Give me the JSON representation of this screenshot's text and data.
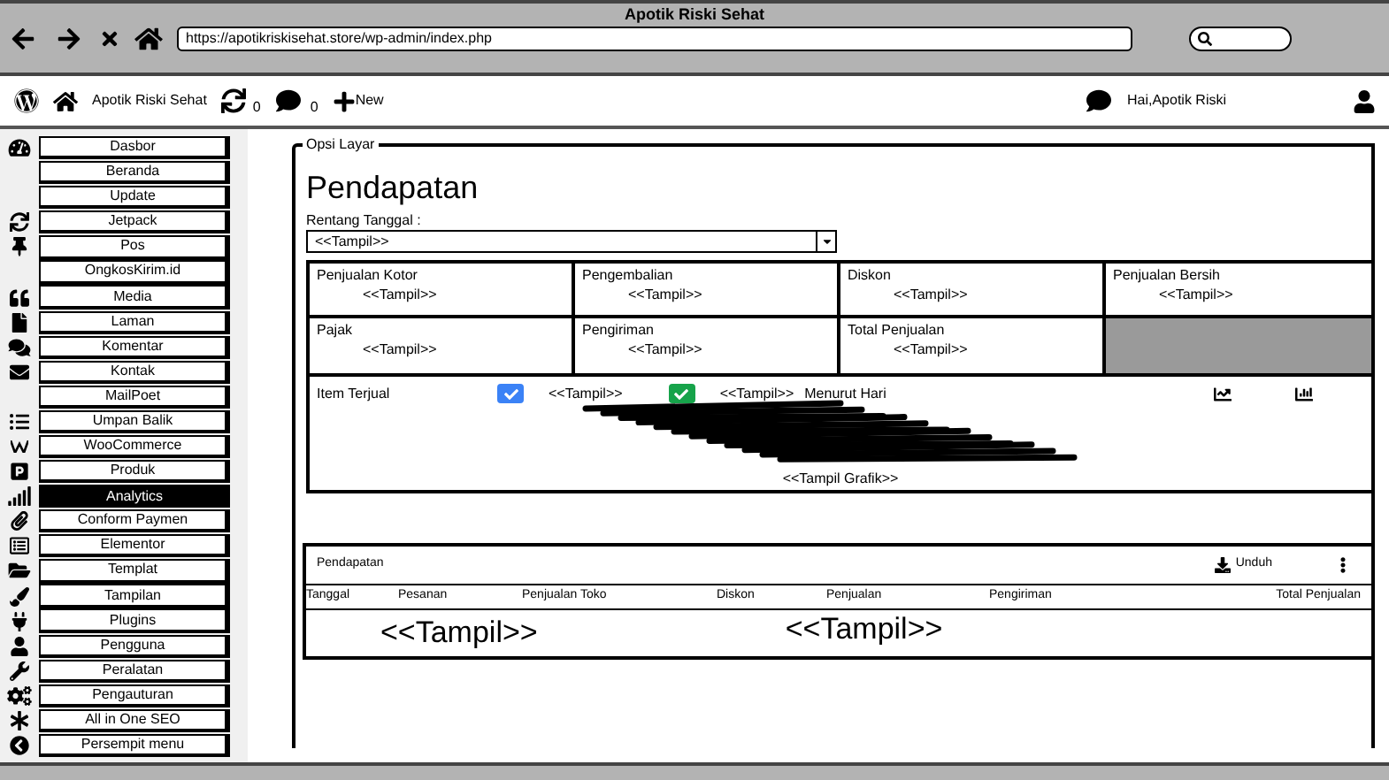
{
  "browser": {
    "title": "Apotik Riski Sehat",
    "url": "https://apotikriskisehat.store/wp-admin/index.php"
  },
  "admin_bar": {
    "site": "Apotik Riski Sehat",
    "updates": "0",
    "comments": "0",
    "new": "New",
    "greeting": "Hai,Apotik Riski"
  },
  "sidebar": {
    "items": [
      {
        "label": "Dasbor",
        "selected": false
      },
      {
        "label": "Beranda",
        "selected": false
      },
      {
        "label": "Update",
        "selected": false
      },
      {
        "label": "Jetpack",
        "selected": false
      },
      {
        "label": "Pos",
        "selected": false
      },
      {
        "label": "OngkosKirim.id",
        "selected": false
      },
      {
        "label": "Media",
        "selected": false
      },
      {
        "label": "Laman",
        "selected": false
      },
      {
        "label": "Komentar",
        "selected": false
      },
      {
        "label": "Kontak",
        "selected": false
      },
      {
        "label": "MailPoet",
        "selected": false
      },
      {
        "label": "Umpan Balik",
        "selected": false
      },
      {
        "label": "WooCommerce",
        "selected": false
      },
      {
        "label": "Produk",
        "selected": false
      },
      {
        "label": "Analytics",
        "selected": true
      },
      {
        "label": "Conform Paymen",
        "selected": false
      },
      {
        "label": "Elementor",
        "selected": false
      },
      {
        "label": "Templat",
        "selected": false
      },
      {
        "label": "Tampilan",
        "selected": false
      },
      {
        "label": "Plugins",
        "selected": false
      },
      {
        "label": "Pengguna",
        "selected": false
      },
      {
        "label": "Peralatan",
        "selected": false
      },
      {
        "label": "Pengauturan",
        "selected": false
      },
      {
        "label": "All in One SEO",
        "selected": false
      },
      {
        "label": "Persempit menu",
        "selected": false
      }
    ]
  },
  "screen_options": "Opsi Layar",
  "page_title": "Pendapatan",
  "date_range": {
    "label": "Rentang Tanggal :",
    "value": "<<Tampil>>"
  },
  "stats": [
    {
      "label": "Penjualan Kotor",
      "value": "<<Tampil>>"
    },
    {
      "label": "Pengembalian",
      "value": "<<Tampil>>"
    },
    {
      "label": "Diskon",
      "value": "<<Tampil>>"
    },
    {
      "label": "Penjualan Bersih",
      "value": "<<Tampil>>"
    },
    {
      "label": "Pajak",
      "value": "<<Tampil>>"
    },
    {
      "label": "Pengiriman",
      "value": "<<Tampil>>"
    },
    {
      "label": "Total Penjualan",
      "value": "<<Tampil>>"
    }
  ],
  "chart_panel": {
    "label": "Item Terjual",
    "series": [
      {
        "checked": true,
        "color": "#3b82f6",
        "value": "<<Tampil>>"
      },
      {
        "checked": true,
        "color": "#16a34a",
        "value": "<<Tampil>>"
      }
    ],
    "interval": "Menurut Hari",
    "caption": "<<Tampil Grafik>>"
  },
  "table": {
    "title": "Pendapatan",
    "download": "Unduh",
    "columns": [
      "Tanggal",
      "Pesanan",
      "Penjualan Toko",
      "Diskon",
      "Penjualan",
      "Pengiriman",
      "Total Penjualan"
    ],
    "placeholders": [
      "<<Tampil>>",
      "<<Tampil>>"
    ]
  }
}
